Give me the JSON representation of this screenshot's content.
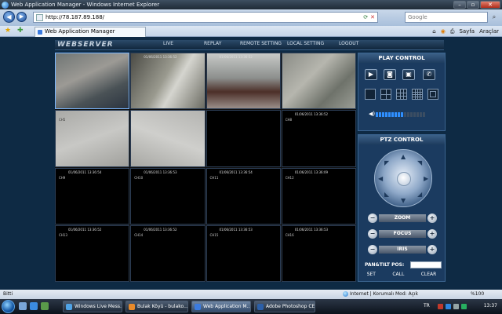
{
  "browser": {
    "window_title": "Web Application Manager - Windows Internet Explorer",
    "url": "http://78.187.89.188/",
    "search_placeholder": "Google",
    "tab_label": "Web Application Manager",
    "tools": [
      "Sayfa",
      "Araçlar"
    ]
  },
  "app": {
    "logo": "WEBSERVER",
    "menu": [
      "LIVE",
      "REPLAY",
      "REMOTE SETTING",
      "LOCAL SETTING",
      "LOGOUT"
    ],
    "channels": [
      {
        "id": 1,
        "timestamp": "",
        "label": ""
      },
      {
        "id": 2,
        "timestamp": "01/06/2011 13:36:52",
        "label": ""
      },
      {
        "id": 3,
        "timestamp": "01/06/2011 13:36:52",
        "label": ""
      },
      {
        "id": 4,
        "timestamp": "",
        "label": ""
      },
      {
        "id": 5,
        "timestamp": "",
        "label": "CH5"
      },
      {
        "id": 6,
        "timestamp": "",
        "label": ""
      },
      {
        "id": 7,
        "timestamp": "",
        "label": ""
      },
      {
        "id": 8,
        "timestamp": "01/06/2011 13:36:52",
        "label": "CH8"
      },
      {
        "id": 9,
        "timestamp": "01/06/2011 13:36:54",
        "label": "CH9"
      },
      {
        "id": 10,
        "timestamp": "01/06/2011 13:36:53",
        "label": "CH10"
      },
      {
        "id": 11,
        "timestamp": "01/06/2011 13:36:54",
        "label": "CH11"
      },
      {
        "id": 12,
        "timestamp": "01/06/2011 13:36:09",
        "label": "CH12"
      },
      {
        "id": 13,
        "timestamp": "01/06/2011 13:36:52",
        "label": "CH13"
      },
      {
        "id": 14,
        "timestamp": "01/06/2011 13:36:52",
        "label": "CH14"
      },
      {
        "id": 15,
        "timestamp": "01/06/2011 13:36:53",
        "label": "CH15"
      },
      {
        "id": 16,
        "timestamp": "01/06/2011 13:36:53",
        "label": "CH16"
      }
    ],
    "play_control": {
      "title": "PLAY CONTROL",
      "volume_level": 0.55
    },
    "ptz_control": {
      "title": "PTZ CONTROL",
      "zoom": "ZOOM",
      "focus": "FOCUS",
      "iris": "IRIS",
      "pan_tilt_label": "PAN&TILT POS:",
      "pan_tilt_value": "",
      "set": "SET",
      "call": "CALL",
      "clear": "CLEAR"
    }
  },
  "statusbar": {
    "left": "Bitti",
    "zone": "Internet | Korumalı Mod: Açık",
    "zoom": "%100"
  },
  "taskbar": {
    "tasks": [
      "Windows Live Mess...",
      "Bulak Köyü - bulako...",
      "Web Application M...",
      "Adobe Photoshop CE"
    ],
    "lang": "TR",
    "clock": "13:37"
  },
  "colors": {
    "page_bg": "#0e2a44",
    "panel_bg": "#1b3b60",
    "accent": "#2f8fff"
  }
}
